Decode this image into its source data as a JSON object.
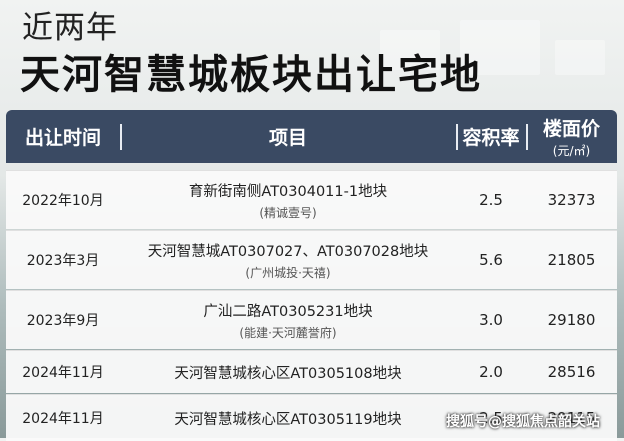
{
  "header": {
    "subtitle": "近两年",
    "title": "天河智慧城板块出让宅地"
  },
  "table": {
    "columns": {
      "date": "出让时间",
      "project": "项目",
      "far": "容积率",
      "price": "楼面价",
      "price_unit": "(元/㎡)"
    },
    "rows": [
      {
        "date": "2022年10月",
        "name": "育新街南侧AT0304011-1地块",
        "sub": "(精诚壹号)",
        "far": "2.5",
        "price": "32373"
      },
      {
        "date": "2023年3月",
        "name": "天河智慧城AT0307027、AT0307028地块",
        "sub": "(广州城投·天禧)",
        "far": "5.6",
        "price": "21805"
      },
      {
        "date": "2023年9月",
        "name": "广汕二路AT0305231地块",
        "sub": "(能建·天河麓誉府)",
        "far": "3.0",
        "price": "29180"
      },
      {
        "date": "2024年11月",
        "name": "天河智慧城核心区AT0305108地块",
        "sub": "",
        "far": "2.0",
        "price": "28516"
      },
      {
        "date": "2024年11月",
        "name": "天河智慧城核心区AT0305119地块",
        "sub": "",
        "far": "2.5",
        "price": "29115"
      }
    ]
  },
  "watermark": "搜狐号@搜狐焦点韶关站"
}
